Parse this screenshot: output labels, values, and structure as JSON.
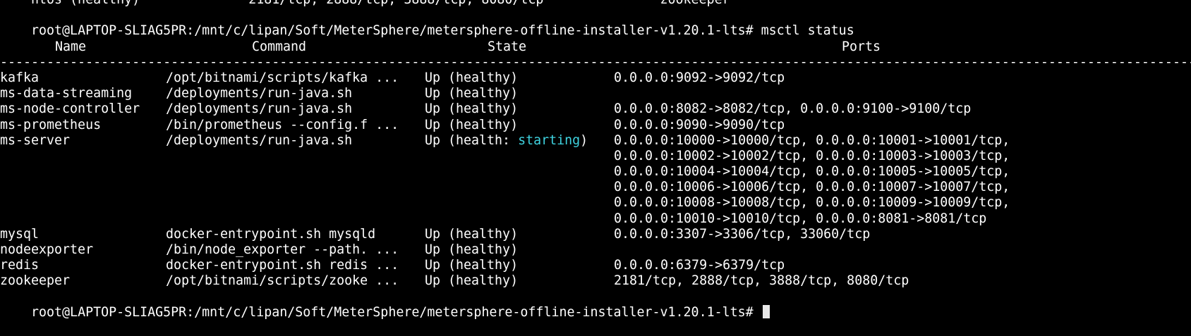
{
  "terminal": {
    "top_fragment": "    ntos (healthy)              2181/tcp, 2888/tcp, 3888/tcp, 8080/tcp               zookeeper",
    "prompt": "root@LAPTOP-SLIAG5PR:/mnt/c/lipan/Soft/MeterSphere/metersphere-offline-installer-v1.20.1-lts# ",
    "command": "msctl status",
    "headers": {
      "name": "Name",
      "command": "Command",
      "state": "State",
      "ports": "Ports"
    },
    "separator": "---------------------------------------------------------------------------------------------------------------------------------------------------------------------------",
    "rows": [
      {
        "name": "kafka",
        "command": "/opt/bitnami/scripts/kafka ...",
        "state": "Up (healthy)",
        "state_highlight": "",
        "state_tail": "",
        "ports": "0.0.0.0:9092->9092/tcp"
      },
      {
        "name": "ms-data-streaming",
        "command": "/deployments/run-java.sh",
        "state": "Up (healthy)",
        "state_highlight": "",
        "state_tail": "",
        "ports": ""
      },
      {
        "name": "ms-node-controller",
        "command": "/deployments/run-java.sh",
        "state": "Up (healthy)",
        "state_highlight": "",
        "state_tail": "",
        "ports": "0.0.0.0:8082->8082/tcp, 0.0.0.0:9100->9100/tcp"
      },
      {
        "name": "ms-prometheus",
        "command": "/bin/prometheus --config.f ...",
        "state": "Up (healthy)",
        "state_highlight": "",
        "state_tail": "",
        "ports": "0.0.0.0:9090->9090/tcp"
      },
      {
        "name": "ms-server",
        "command": "/deployments/run-java.sh",
        "state": "Up (health: ",
        "state_highlight": "starting",
        "state_tail": ")",
        "ports": "0.0.0.0:10000->10000/tcp, 0.0.0.0:10001->10001/tcp,"
      },
      {
        "name": "",
        "command": "",
        "state": "",
        "state_highlight": "",
        "state_tail": "",
        "ports": "0.0.0.0:10002->10002/tcp, 0.0.0.0:10003->10003/tcp,"
      },
      {
        "name": "",
        "command": "",
        "state": "",
        "state_highlight": "",
        "state_tail": "",
        "ports": "0.0.0.0:10004->10004/tcp, 0.0.0.0:10005->10005/tcp,"
      },
      {
        "name": "",
        "command": "",
        "state": "",
        "state_highlight": "",
        "state_tail": "",
        "ports": "0.0.0.0:10006->10006/tcp, 0.0.0.0:10007->10007/tcp,"
      },
      {
        "name": "",
        "command": "",
        "state": "",
        "state_highlight": "",
        "state_tail": "",
        "ports": "0.0.0.0:10008->10008/tcp, 0.0.0.0:10009->10009/tcp,"
      },
      {
        "name": "",
        "command": "",
        "state": "",
        "state_highlight": "",
        "state_tail": "",
        "ports": "0.0.0.0:10010->10010/tcp, 0.0.0.0:8081->8081/tcp"
      },
      {
        "name": "mysql",
        "command": "docker-entrypoint.sh mysqld",
        "state": "Up (healthy)",
        "state_highlight": "",
        "state_tail": "",
        "ports": "0.0.0.0:3307->3306/tcp, 33060/tcp"
      },
      {
        "name": "nodeexporter",
        "command": "/bin/node_exporter --path. ...",
        "state": "Up (healthy)",
        "state_highlight": "",
        "state_tail": "",
        "ports": ""
      },
      {
        "name": "redis",
        "command": "docker-entrypoint.sh redis ...",
        "state": "Up (healthy)",
        "state_highlight": "",
        "state_tail": "",
        "ports": "0.0.0.0:6379->6379/tcp"
      },
      {
        "name": "zookeeper",
        "command": "/opt/bitnami/scripts/zooke ...",
        "state": "Up (healthy)",
        "state_highlight": "",
        "state_tail": "",
        "ports": "2181/tcp, 2888/tcp, 3888/tcp, 8080/tcp"
      }
    ],
    "bottom_fragment": "root@LAPTOP-SLIAG5PR:/mnt/c/lipan/Soft/MeterSphere/metersphere-offline-installer-v1.20.1-lts# ",
    "colors": {
      "background": "#000000",
      "foreground": "#ffffff",
      "highlight": "#3fd3e0",
      "cursor": "#e8e8e8"
    }
  }
}
